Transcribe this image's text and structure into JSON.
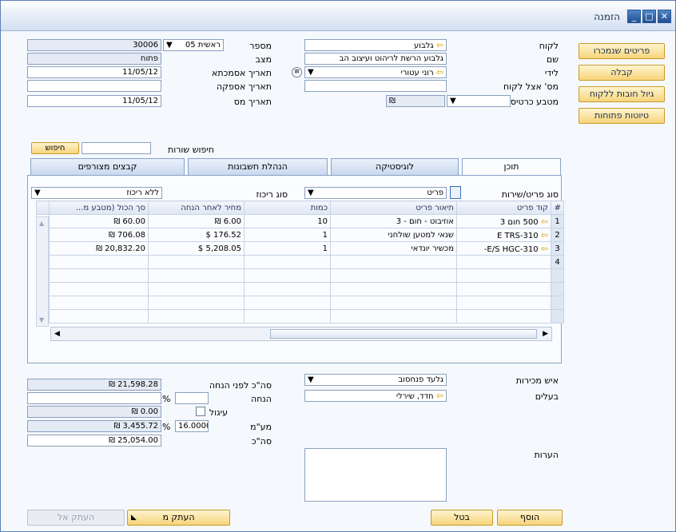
{
  "window": {
    "title": "הזמנה"
  },
  "sidebar_buttons": [
    "פריטים שנמכרו",
    "קבלה",
    "גיול חובות ללקוח",
    "טיוטות פתוחות"
  ],
  "header_right": {
    "customer_label": "לקוח",
    "customer_value": "גלבוע",
    "name_label": "שם",
    "name_value": "גלבוע הרשת לריהוט ועיצוב הב",
    "contact_label": "לידי",
    "contact_value": "רוני עטורי",
    "custref_label": "מס' אצל לקוח",
    "custref_value": "",
    "currency_label": "מטבע כרטיס",
    "currency_value": "₪"
  },
  "header_left": {
    "number_label": "מספר",
    "series_value": "ראשית 05",
    "number_value": "30006",
    "status_label": "מצב",
    "status_value": "פתוח",
    "docdate_label": "תאריך אסמכתא",
    "docdate_value": "11/05/12",
    "deliv_label": "תאריך אספקה",
    "deliv_value": "",
    "taxdate_label": "תאריך מס",
    "taxdate_value": "11/05/12"
  },
  "row_search": {
    "label": "חיפוש שורות",
    "button": "חיפוש"
  },
  "tabs": [
    "תוכן",
    "לוגיסטיקה",
    "הנהלת חשבונות",
    "קבצים מצורפים"
  ],
  "content": {
    "itemtype_label": "סוג פריט/שירות",
    "itemtype_value": "פריט",
    "summary_label": "סוג ריכוז",
    "summary_value": "ללא ריכוז"
  },
  "grid": {
    "headers": [
      "#",
      "קוד פריט",
      "תיאור פריט",
      "כמות",
      "מחיר לאחר הנחה",
      "סך הכול (מטבע מ..."
    ],
    "rows": [
      [
        "1",
        "500 חום 3",
        "אוזיבוט - חום - 3",
        "10",
        "₪ 6.00",
        "₪ 60.00"
      ],
      [
        "2",
        "E TRS-310",
        "שנאי למטען שולחני",
        "1",
        "$ 176.52",
        "₪ 706.08"
      ],
      [
        "3",
        "E/S HGC-310-",
        "מכשיר יונדאי",
        "1",
        "$ 5,208.05",
        "₪ 20,832.20"
      ],
      [
        "4",
        "",
        "",
        "",
        "",
        ""
      ]
    ]
  },
  "footer_right": {
    "salesperson_label": "איש מכירות",
    "salesperson_value": "גלעד פנחסוב",
    "owner_label": "בעלים",
    "owner_value": "חדד, שירלי",
    "remarks_label": "הערות"
  },
  "footer_left": {
    "before_disc_label": "סה\"כ לפני הנחה",
    "before_disc_value": "₪ 21,598.28",
    "discount_label": "הנחה",
    "discount_pct": "%",
    "rounding_label": "עיגול",
    "rounding_value": "₪ 0.00",
    "vat_label": "מע\"מ",
    "vat_rate": "16.0000",
    "vat_pct": "%",
    "vat_value": "₪ 3,455.72",
    "total_label": "סה\"כ",
    "total_value": "₪ 25,054.00"
  },
  "buttons": {
    "add": "הוסף",
    "cancel": "בטל",
    "copy_from": "העתק מ",
    "copy_to": "העתק אל"
  }
}
